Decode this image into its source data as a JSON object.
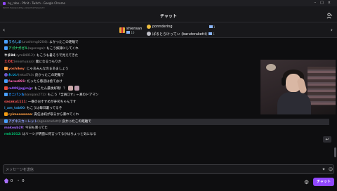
{
  "window": {
    "title": "by_rabe - Pfinit - Twitch - Google Chrome",
    "url": "twitch.tv/popout/by_rabe/chat?popout="
  },
  "header": {
    "title": "チャット"
  },
  "leaderboard": {
    "left": [
      {
        "name": "shiensan",
        "count": "10"
      }
    ],
    "right": [
      {
        "name": "ponndering",
        "count": "1"
      },
      {
        "name": "ぱるとらけってぃ (barutoraketti)",
        "count": "1"
      }
    ]
  },
  "messages": [
    {
      "user": "うらしま",
      "user_color": "#4fb7ff",
      "login": "(urashimg0204)",
      "text": ": よかったこの距離で"
    },
    {
      "user": "アゴナガゼル",
      "user_color": "#2ecc71",
      "login": "(agonaga)",
      "text": ": もこう奴隷にしてくれ"
    },
    {
      "user": "やま84",
      "user_color": "#ffffff",
      "login": "(rym84012)",
      "text": ": もこうも暑そうで見えてきた"
    },
    {
      "user": "えのむ",
      "user_color": "#ff4f4f",
      "login": "(enomuaaa)",
      "text": ": 腹になるつもりか"
    },
    {
      "user": "yoshikey",
      "user_color": "#ff7f50",
      "login": "",
      "text": ": じゃあみんなのまあましょう"
    },
    {
      "user": "れつい",
      "user_color": "#00bfff",
      "login": "(retui7ki)",
      "text": ": 良かったこの距離で"
    },
    {
      "user": "fucas891",
      "user_color": "#ff69b4",
      "login": "",
      "text": ": だったら慈悲は捨ておけ"
    },
    {
      "user": "m009jpgjmjp",
      "user_color": "#9b59ff",
      "login": "",
      "text": ": もこたん最後好哉！？"
    },
    {
      "user": "カニパンA",
      "user_color": "#1e90ff",
      "login": "(kanipan271)",
      "text": ": もこう「全員〇す」←真のドアマン"
    },
    {
      "user": "sasaku1111",
      "user_color": "#ff5c5c",
      "login": "",
      "text": ": 一番のおすすめが寿司ちゃんです"
    },
    {
      "user": "i_am_tab00",
      "user_color": "#3498db",
      "login": "",
      "text": ": もこうは毎日暑ってるぞ"
    },
    {
      "user": "ryimeaaaaaa",
      "user_color": "#ff9f43",
      "login": "",
      "text": ": 責任は純が取るから暴れてくれ"
    },
    {
      "user": "アグネスカーレット",
      "user_color": "#8fa3ff",
      "login": "(agnescarlett)",
      "text": ": 良かったこの距離で"
    },
    {
      "user": "makoub20",
      "user_color": "#a970ff",
      "login": "",
      "text": ": 今日も害ってた"
    },
    {
      "user": "rmk1012",
      "user_color": "#00c070",
      "login": "",
      "text": ": はリーシが明面に何言ってるかはちょっと気になる"
    }
  ],
  "composer": {
    "placeholder": "メッセージを送信"
  },
  "footer": {
    "points": "0",
    "points_value": "0",
    "chat_button": "チャット"
  },
  "colors": {
    "accent": "#9147ff",
    "background": "#0e0e10",
    "panel": "#18181b"
  }
}
